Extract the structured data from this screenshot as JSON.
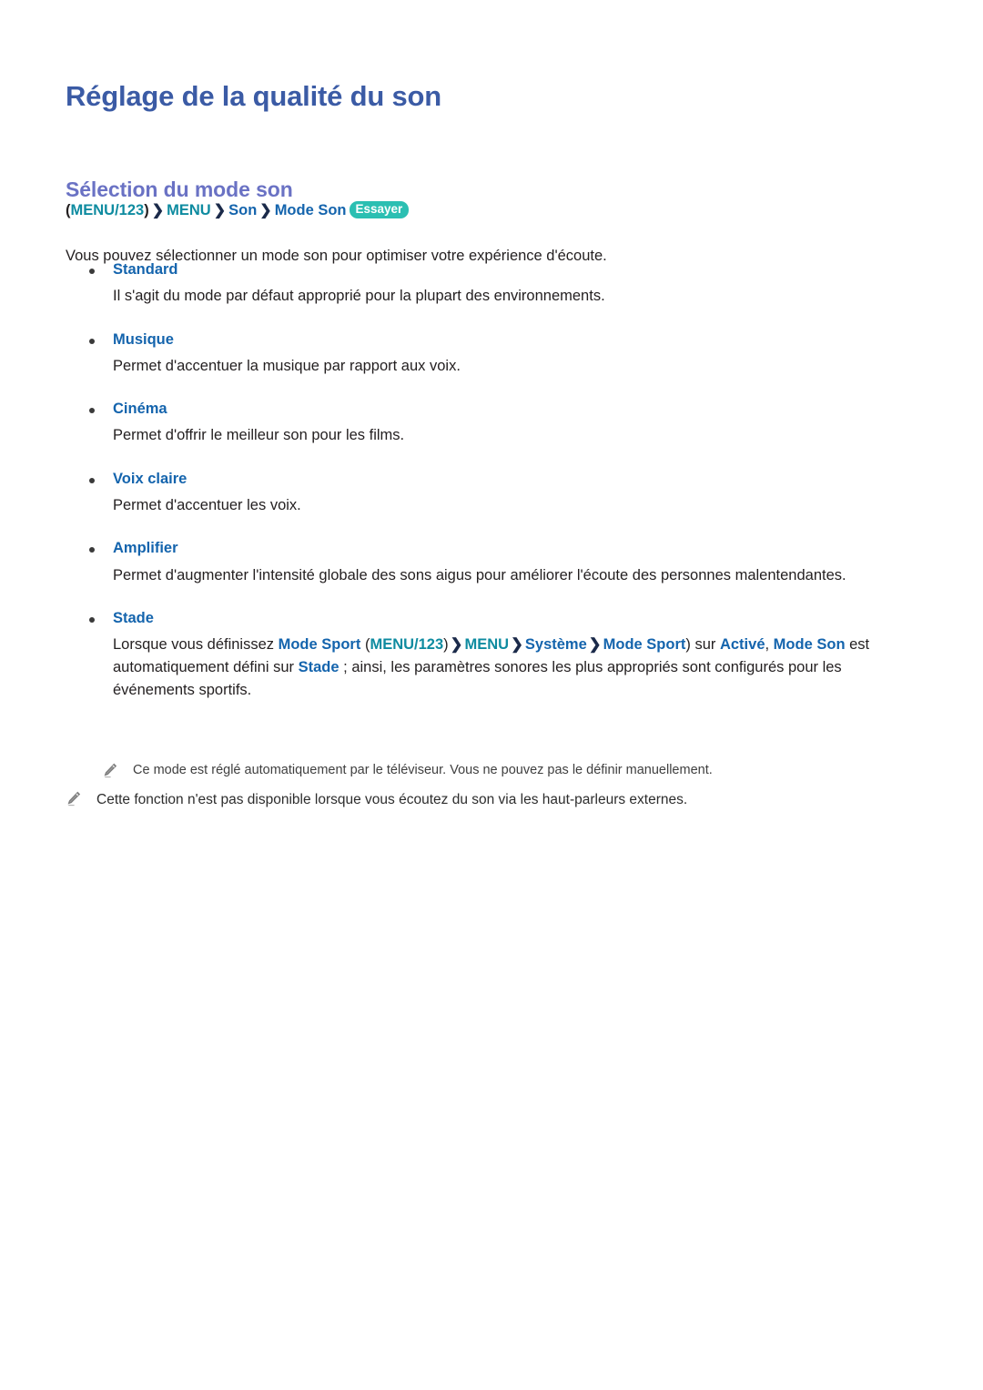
{
  "document": {
    "title": "Réglage de la qualité du son",
    "section_title": "Sélection du mode son"
  },
  "colors": {
    "title_blue": "#3b5ba5",
    "section_purple": "#6a72c4",
    "link_blue": "#1464ad",
    "teal": "#0e8ba0",
    "badge_teal": "#2bbfb2",
    "body_text": "#231f20",
    "note_text": "#3f3f3f"
  },
  "breadcrumb": {
    "open_paren": "(",
    "menu123": "MENU/123",
    "close_paren": ")",
    "separator": "❯",
    "menu": "MENU",
    "son": "Son",
    "mode_son": "Mode Son",
    "badge": "Essayer"
  },
  "intro": "Vous pouvez sélectionner un mode son pour optimiser votre expérience d'écoute.",
  "modes": [
    {
      "label": "Standard",
      "description": "Il s'agit du mode par défaut approprié pour la plupart des environnements."
    },
    {
      "label": "Musique",
      "description": "Permet d'accentuer la musique par rapport aux voix."
    },
    {
      "label": "Cinéma",
      "description": "Permet d'offrir le meilleur son pour les films."
    },
    {
      "label": "Voix claire",
      "description": "Permet d'accentuer les voix."
    },
    {
      "label": "Amplifier",
      "description": "Permet d'augmenter l'intensité globale des sons aigus pour améliorer l'écoute des personnes malentendantes."
    },
    {
      "label": "Stade",
      "description": ""
    }
  ],
  "stade_paragraph": {
    "t1": "Lorsque vous définissez ",
    "mode_sport_1": "Mode Sport",
    "t2": " (",
    "open_paren": "(",
    "menu123": "MENU/123",
    "close_paren": ")",
    "sep": "❯",
    "menu": "MENU",
    "systeme": "Système",
    "mode_sport_2": "Mode Sport",
    "t3": ") sur ",
    "active": "Activé",
    "comma": ", ",
    "mode": "Mode",
    "son": "Son",
    "t4": " est automatiquement défini sur ",
    "stade": "Stade",
    "t5": " ; ainsi, les paramètres sonores les plus appropriés sont configurés pour les événements sportifs."
  },
  "notes": [
    {
      "icon": "pencil-icon",
      "text": "Ce mode est réglé automatiquement par le téléviseur. Vous ne pouvez pas le définir manuellement.",
      "indented": true
    },
    {
      "icon": "pencil-icon",
      "text": "Cette fonction n'est pas disponible lorsque vous écoutez du son via les haut-parleurs externes.",
      "indented": false
    }
  ]
}
